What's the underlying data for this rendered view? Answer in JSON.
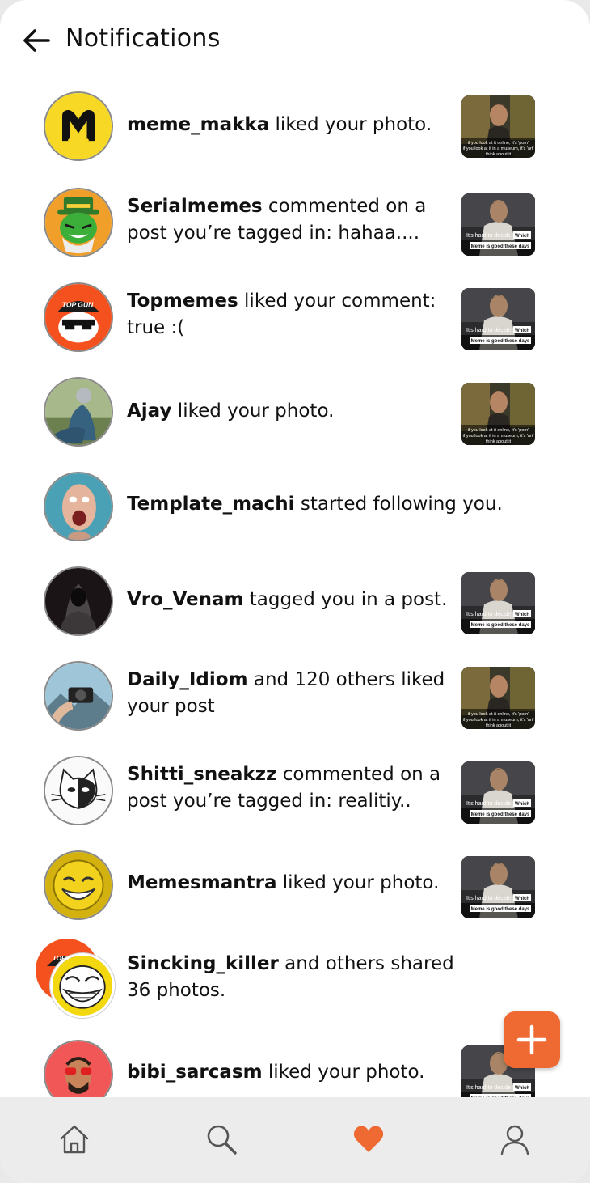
{
  "header": {
    "title": "Notifications",
    "back_icon": "arrow-left-icon"
  },
  "colors": {
    "accent": "#ef6a33",
    "nav_bg": "#ececec",
    "text": "#111111"
  },
  "notifications": [
    {
      "user": "meme_makka",
      "message": " liked your photo.",
      "avatar": "meme-makka-logo",
      "thumb": "meme-post-porn-art"
    },
    {
      "user": "Serialmemes",
      "message": " commented on a post you’re tagged in: hahaa....",
      "avatar": "serialmemes-logo",
      "thumb": "meme-post-hard-to-decide"
    },
    {
      "user": "Topmemes",
      "message": " liked your comment: true :(",
      "avatar": "topmemes-logo",
      "thumb": "meme-post-hard-to-decide"
    },
    {
      "user": "Ajay",
      "message": " liked your photo.",
      "avatar": "ajay-photo",
      "thumb": "meme-post-porn-art"
    },
    {
      "user": "Template_machi",
      "message": " started following you.",
      "avatar": "template-machi-photo",
      "thumb": ""
    },
    {
      "user": "Vro_Venam",
      "message": " tagged you in a post.",
      "avatar": "vro-venam-photo",
      "thumb": "meme-post-hard-to-decide"
    },
    {
      "user": "Daily_Idiom",
      "message": " and 120 others liked your post",
      "avatar": "daily-idiom-photo",
      "thumb": "meme-post-porn-art"
    },
    {
      "user": "Shitti_sneakzz",
      "message": " commented on a post you’re tagged in: realitiy..",
      "avatar": "shitti-sneakzz-logo",
      "thumb": "meme-post-hard-to-decide"
    },
    {
      "user": "Memesmantra",
      "message": " liked your photo.",
      "avatar": "memesmantra-logo",
      "thumb": "meme-post-hard-to-decide"
    },
    {
      "user": "Sincking_killer",
      "message": " and others shared 36 photos.",
      "avatar": "sincking-killer-stack",
      "thumb": ""
    },
    {
      "user": "bibi_sarcasm",
      "message": " liked your photo.",
      "avatar": "bibi-sarcasm-logo",
      "thumb": "meme-post-hard-to-decide"
    }
  ],
  "thumbs": {
    "porn_art": {
      "line1": "if you look at it online, it's 'porn'",
      "line2": "if you look at it in a museum, it's 'art'",
      "line3": "think about it"
    },
    "hard_to_decide": {
      "line1": "It's hard to decide",
      "tag": "Which",
      "line2": "Meme is good these days"
    }
  },
  "avatar_text": {
    "topgun": "TOP GUN"
  },
  "fab": {
    "icon": "plus-icon"
  },
  "nav": [
    {
      "icon": "home-icon",
      "active": false
    },
    {
      "icon": "search-icon",
      "active": false
    },
    {
      "icon": "heart-icon",
      "active": true
    },
    {
      "icon": "profile-icon",
      "active": false
    }
  ]
}
